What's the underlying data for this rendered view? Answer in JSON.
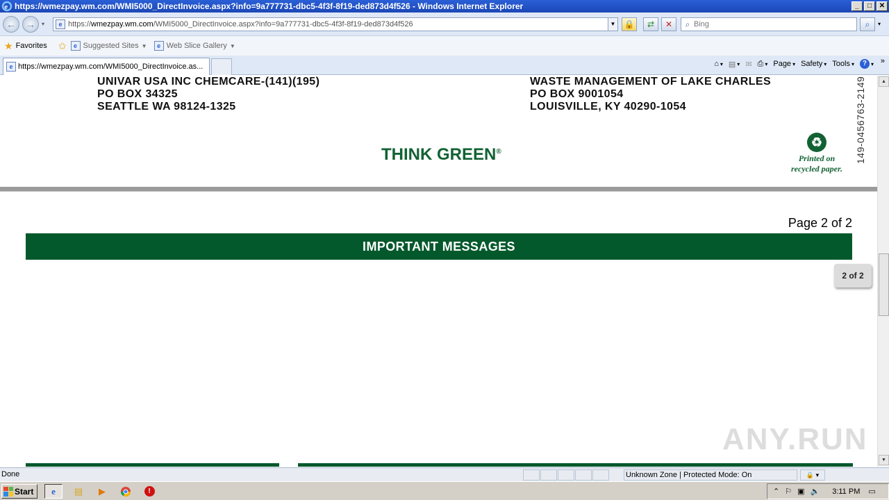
{
  "window": {
    "title": "https://wmezpay.wm.com/WMI5000_DirectInvoice.aspx?info=9a777731-dbc5-4f3f-8f19-ded873d4f526 - Windows Internet Explorer",
    "min": "_",
    "max": "□",
    "close": "✕"
  },
  "nav": {
    "back": "←",
    "forward": "→",
    "url_prefix": "https://",
    "url_domain": "wmezpay.wm.com",
    "url_rest": "/WMI5000_DirectInvoice.aspx?info=9a777731-dbc5-4f3f-8f19-ded873d4f526",
    "search_placeholder": "Bing"
  },
  "favorites": {
    "favorites_label": "Favorites",
    "suggested_sites": "Suggested Sites",
    "web_slice_gallery": "Web Slice Gallery"
  },
  "tabs": {
    "active_tab": "https://wmezpay.wm.com/WMI5000_DirectInvoice.as..."
  },
  "commands": {
    "page": "Page",
    "safety": "Safety",
    "tools": "Tools",
    "help": "?"
  },
  "invoice": {
    "customer": {
      "line1": "UNIVAR USA INC CHEMCARE-(141)(195)",
      "line2": "PO BOX 34325",
      "line3": "SEATTLE WA 98124-1325"
    },
    "remit": {
      "line1": "WASTE MANAGEMENT OF LAKE CHARLES",
      "line2": "PO BOX 9001054",
      "line3": "LOUISVILLE, KY 40290-1054"
    },
    "slogan": "THINK GREEN",
    "slogan_mark": "®",
    "recycled_line1": "Printed on",
    "recycled_line2": "recycled paper.",
    "vertical_number": "149-0456763-2149",
    "page_label": "Page 2 of 2",
    "messages_header": "IMPORTANT MESSAGES",
    "page_indicator": "2 of 2"
  },
  "watermark": "ANY.RUN",
  "status": {
    "done": "Done",
    "zone": "Unknown Zone | Protected Mode: On",
    "zoom": "🔒 ▾"
  },
  "taskbar": {
    "start": "Start",
    "clock": "3:11 PM"
  },
  "colors": {
    "wm_green": "#04592c",
    "title_blue": "#1c47b6"
  }
}
